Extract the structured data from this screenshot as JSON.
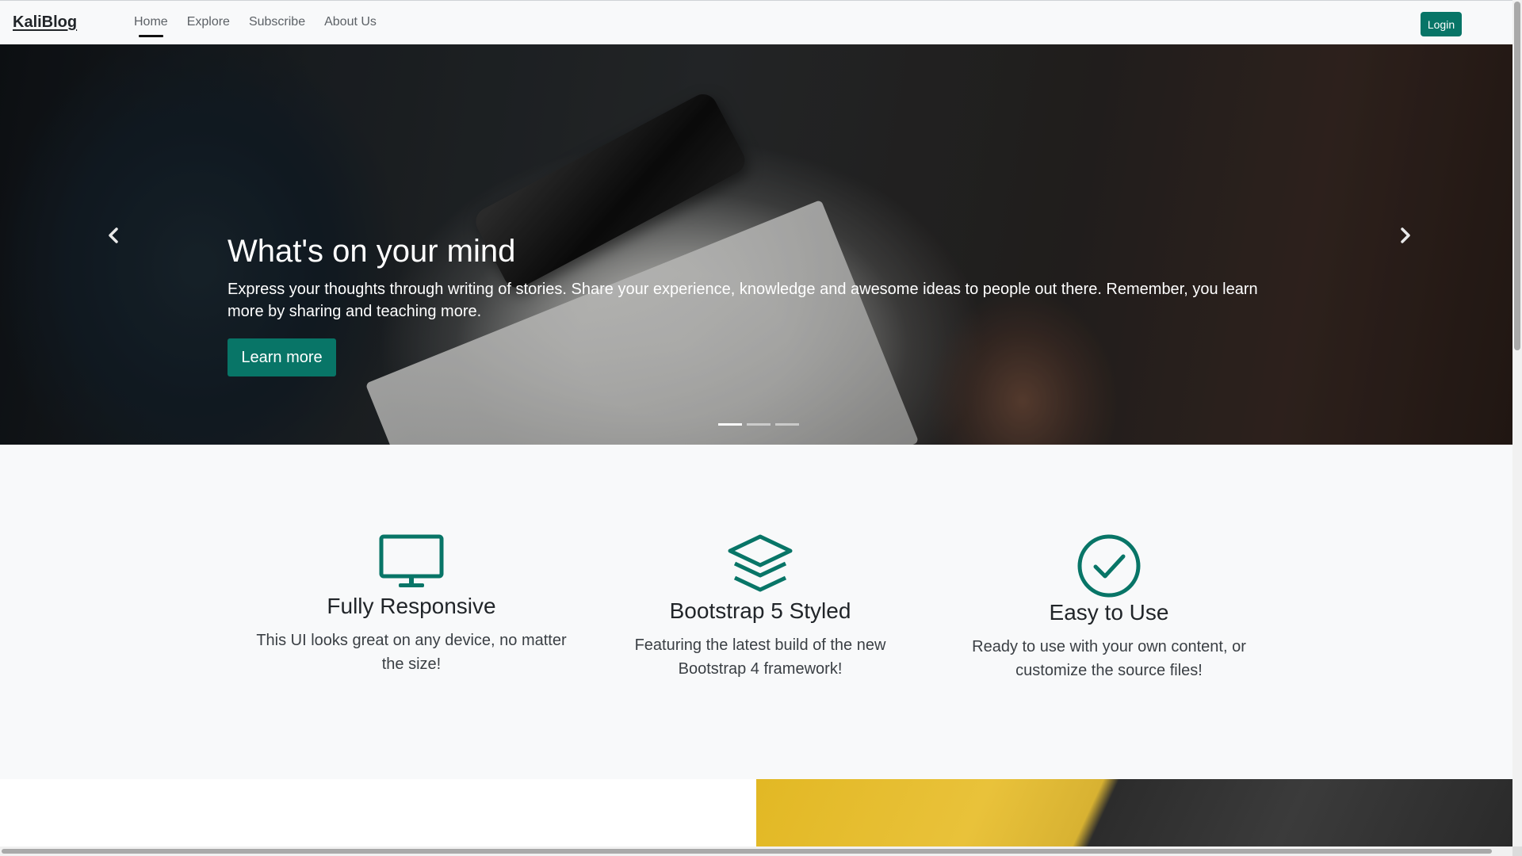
{
  "colors": {
    "accent": "#087567",
    "navbar_bg": "#f8f9fa",
    "features_bg": "#f8f9fa",
    "text_dark": "#212529"
  },
  "navbar": {
    "brand": "KaliBlog",
    "links": [
      {
        "label": "Home",
        "active": true
      },
      {
        "label": "Explore",
        "active": false
      },
      {
        "label": "Subscribe",
        "active": false
      },
      {
        "label": "About Us",
        "active": false
      }
    ],
    "login_label": "Login"
  },
  "hero": {
    "title": "What's on your mind",
    "text": "Express your thoughts through writing of stories. Share your experience, knowledge and awesome ideas to people out there. Remember, you learn more by sharing and teaching more.",
    "button_label": "Learn more",
    "prev_icon": "chevron-left-icon",
    "next_icon": "chevron-right-icon",
    "slide_count": 3,
    "active_slide": 1
  },
  "features": [
    {
      "icon": "monitor-icon",
      "title": "Fully Responsive",
      "text": "This UI looks great on any device, no matter the size!"
    },
    {
      "icon": "layers-icon",
      "title": "Bootstrap 5 Styled",
      "text": "Featuring the latest build of the new Bootstrap 4 framework!"
    },
    {
      "icon": "check-circle-icon",
      "title": "Easy to Use",
      "text": "Ready to use with your own content, or customize the source files!"
    }
  ]
}
